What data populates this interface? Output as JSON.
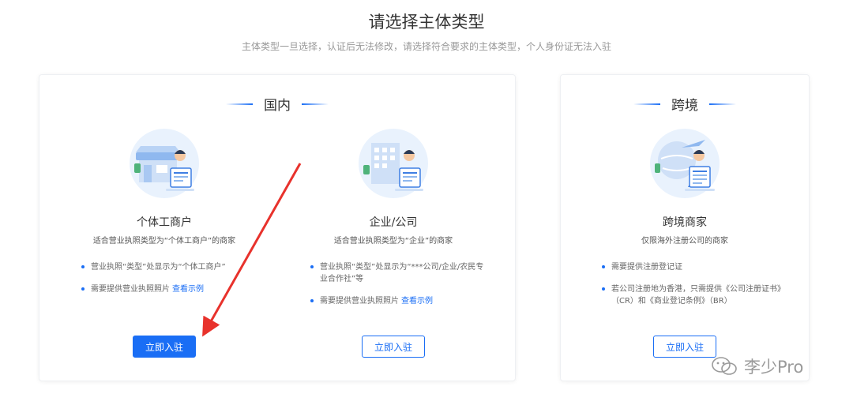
{
  "page": {
    "title": "请选择主体类型",
    "subtitle": "主体类型一旦选择，认证后无法修改，请选择符合要求的主体类型，个人身份证无法入驻"
  },
  "domestic": {
    "heading": "国内",
    "options": [
      {
        "title": "个体工商户",
        "desc": "适合营业执照类型为“个体工商户”的商家",
        "bullets": [
          "营业执照“类型”处显示为“个体工商户”",
          "需要提供营业执照照片"
        ],
        "example_link": "查看示例",
        "button": "立即入驻"
      },
      {
        "title": "企业/公司",
        "desc": "适合营业执照类型为“企业”的商家",
        "bullets": [
          "营业执照“类型”处显示为“***公司/企业/农民专业合作社”等",
          "需要提供营业执照照片"
        ],
        "example_link": "查看示例",
        "button": "立即入驻"
      }
    ]
  },
  "crossborder": {
    "heading": "跨境",
    "option": {
      "title": "跨境商家",
      "desc": "仅限海外注册公司的商家",
      "bullets": [
        "需要提供注册登记证",
        "若公司注册地为香港，只需提供《公司注册证书》（CR）和《商业登记条例》（BR）"
      ],
      "button": "立即入驻"
    }
  },
  "watermark": "李少Pro",
  "colors": {
    "accent": "#1a6ef5",
    "arrow": "#e8322c"
  }
}
